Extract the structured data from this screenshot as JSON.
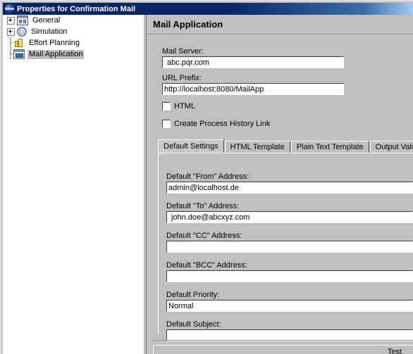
{
  "window": {
    "title": "Properties for Confirmation Mail",
    "icon": "globe-icon"
  },
  "tree": {
    "items": [
      {
        "label": "General",
        "icon": "window-icon",
        "expander": "plus",
        "selected": false
      },
      {
        "label": "Simulation",
        "icon": "spiral-icon",
        "expander": "plus",
        "selected": false
      },
      {
        "label": "Effort Planning",
        "icon": "coins-icon",
        "expander": "none",
        "selected": false
      },
      {
        "label": "Mail Application",
        "icon": "mail-window-icon",
        "expander": "none",
        "selected": true
      }
    ]
  },
  "panel": {
    "title": "Mail Application",
    "mail_server": {
      "label": "Mail Server:",
      "value": "abc.pqr.com"
    },
    "url_prefix": {
      "label": "URL Prefix:",
      "value": "http://localhost:8080/MailApp"
    },
    "checkboxes": [
      {
        "label": "HTML",
        "checked": false
      },
      {
        "label": "Create Process History Link",
        "checked": false
      }
    ],
    "tabs": [
      {
        "label": "Default Settings",
        "active": true
      },
      {
        "label": "HTML Template",
        "active": false
      },
      {
        "label": "Plain Text Template",
        "active": false
      },
      {
        "label": "Output Values",
        "active": false
      }
    ],
    "default_settings": {
      "from": {
        "label": "Default \"From\" Address:",
        "value": "admin@localhost.de"
      },
      "to": {
        "label": "Default \"To\" Address:",
        "value": "john.doe@abcxyz.com"
      },
      "cc": {
        "label": "Default \"CC\" Address:",
        "value": ""
      },
      "bcc": {
        "label": "Default \"BCC\" Address:",
        "value": ""
      },
      "priority": {
        "label": "Default Priority:",
        "value": "Normal"
      },
      "subject": {
        "label": "Default Subject:",
        "value": ""
      }
    },
    "test_button": "Test"
  },
  "colors": {
    "titlebar_start": "#0a246a",
    "titlebar_end": "#a6caf0",
    "dialog_face": "#c0c0c0",
    "selection": "#bfbfbf",
    "field_bg": "#ffffff"
  }
}
